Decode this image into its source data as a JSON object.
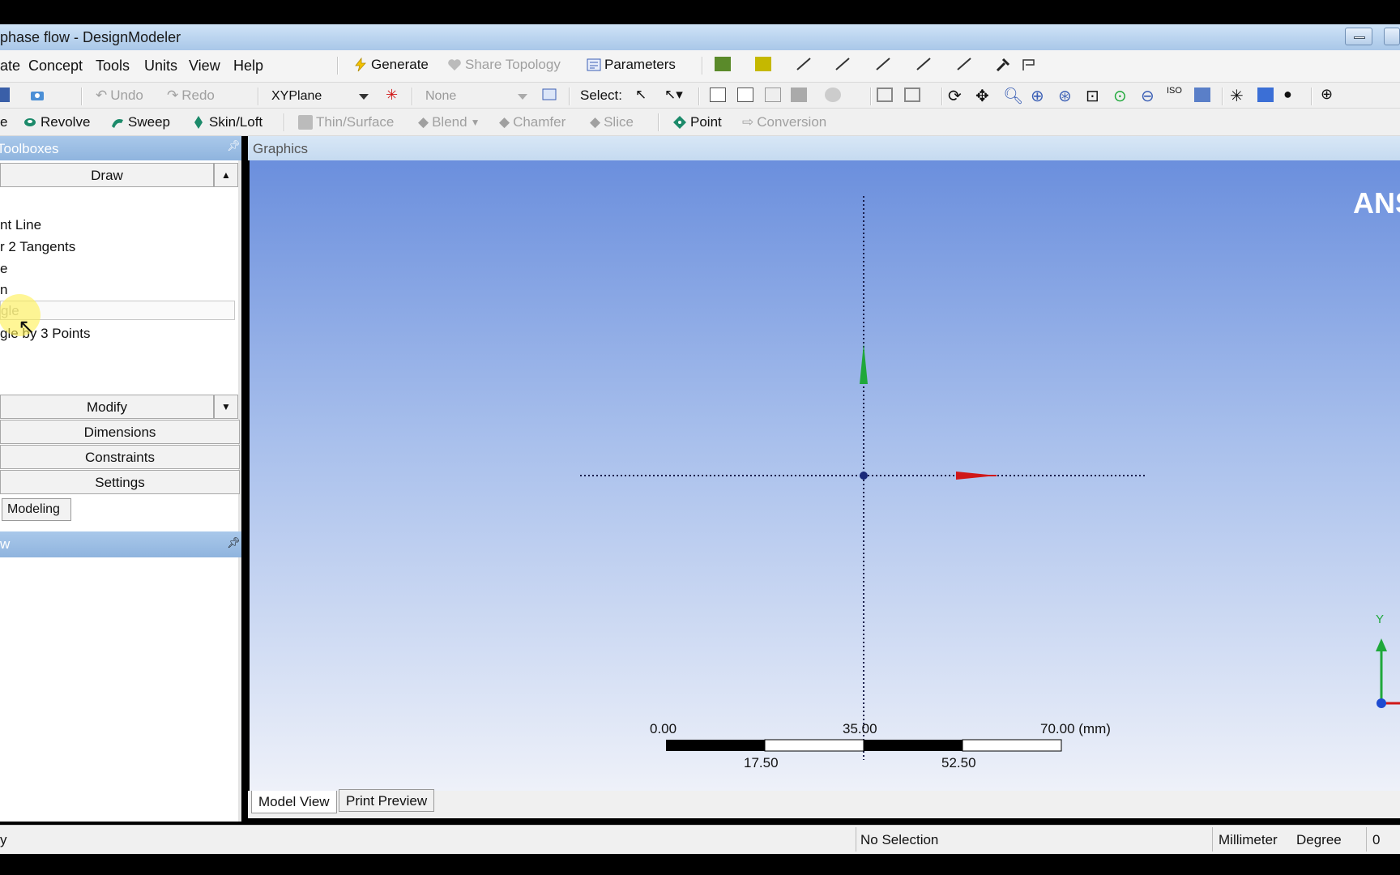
{
  "window": {
    "title": "phase flow - DesignModeler"
  },
  "menu": [
    "ate",
    "Concept",
    "Tools",
    "Units",
    "View",
    "Help"
  ],
  "toolbar_main": {
    "generate": "Generate",
    "share_topology": "Share Topology",
    "parameters": "Parameters"
  },
  "toolbar1": {
    "undo": "Undo",
    "redo": "Redo",
    "plane_select": "XYPlane",
    "sketch_select": "None",
    "select_label": "Select:"
  },
  "toolbar2": {
    "extrude_partial": "e",
    "revolve": "Revolve",
    "sweep": "Sweep",
    "skinloft": "Skin/Loft",
    "thin_surface": "Thin/Surface",
    "blend": "Blend",
    "chamfer": "Chamfer",
    "slice": "Slice",
    "point": "Point",
    "conversion": "Conversion"
  },
  "toolboxes": {
    "header": "Toolboxes",
    "draw": "Draw",
    "draw_items": [
      "nt Line",
      "r 2 Tangents",
      "e",
      "n",
      "gle",
      "gle by 3 Points"
    ],
    "modify": "Modify",
    "dimensions": "Dimensions",
    "constraints": "Constraints",
    "settings": "Settings",
    "modeling_tab": "Modeling",
    "tree_header": "w"
  },
  "graphics": {
    "header": "Graphics",
    "logo_partial": "ANS",
    "triad_y": "Y",
    "scale": {
      "top_labels": [
        "0.00",
        "35.00",
        "70.00 (mm)"
      ],
      "bottom_labels": [
        "17.50",
        "52.50"
      ]
    }
  },
  "bottom_tabs": {
    "model_view": "Model View",
    "print_preview": "Print Preview"
  },
  "status": {
    "left": "y",
    "selection": "No Selection",
    "unit_length": "Millimeter",
    "unit_angle": "Degree",
    "value": "0"
  },
  "colors": {
    "graphics_top": "#6b8fdd",
    "graphics_bottom": "#eef1f9",
    "axis_green": "#1fa83a",
    "axis_red": "#d01818",
    "header_blue": "#8fb4de"
  }
}
